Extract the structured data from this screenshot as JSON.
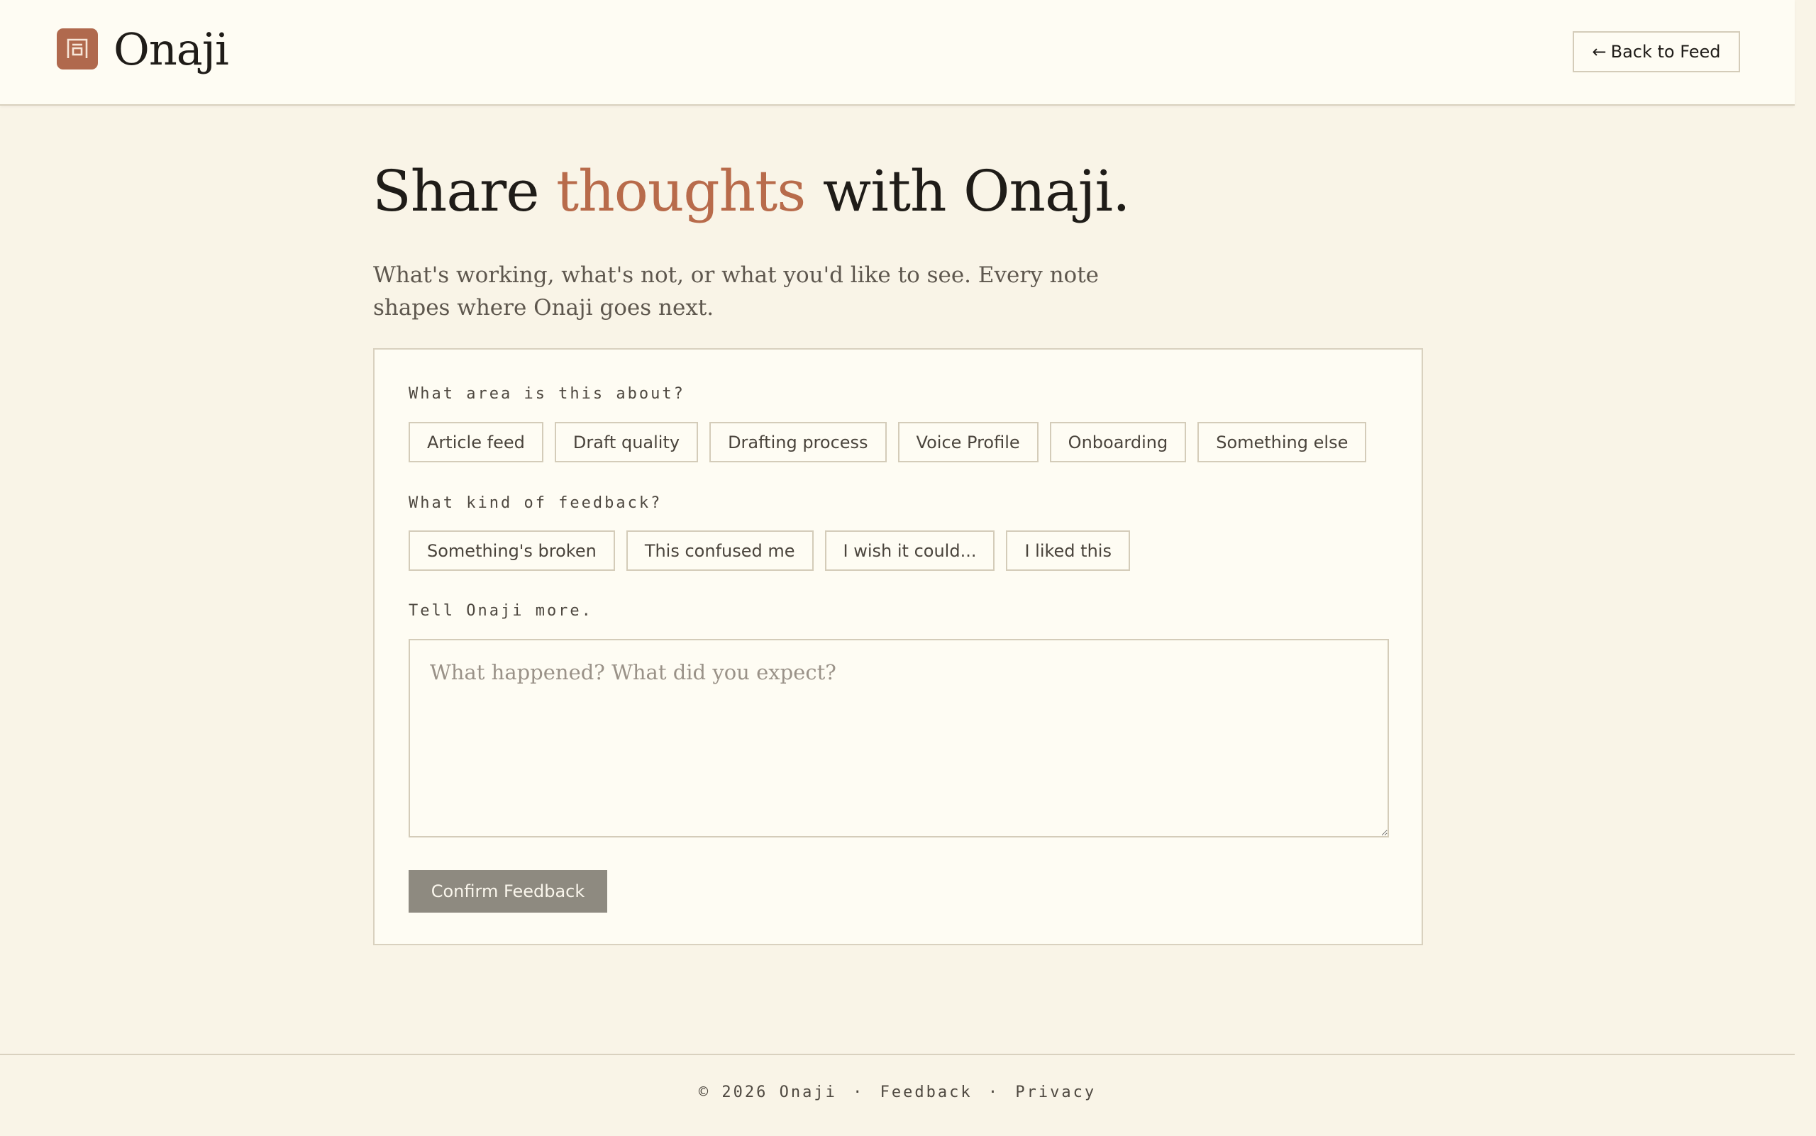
{
  "header": {
    "brand_name": "Onaji",
    "brand_mark_glyph": "同",
    "back_label": "Back to Feed",
    "back_arrow": "←"
  },
  "hero": {
    "headline_before": "Share ",
    "headline_accent": "thoughts",
    "headline_after": " with Onaji.",
    "subtitle": "What's working, what's not, or what you'd like to see. Every note shapes where Onaji goes next."
  },
  "form": {
    "area_label": "What area is this about?",
    "area_options": [
      "Article feed",
      "Draft quality",
      "Drafting process",
      "Voice Profile",
      "Onboarding",
      "Something else"
    ],
    "kind_label": "What kind of feedback?",
    "kind_options": [
      "Something's broken",
      "This confused me",
      "I wish it could...",
      "I liked this"
    ],
    "details_label": "Tell Onaji more.",
    "details_placeholder": "What happened? What did you expect?",
    "details_value": "",
    "submit_label": "Confirm Feedback"
  },
  "footer": {
    "copyright": "© 2026 Onaji",
    "separator": "·",
    "feedback_link": "Feedback",
    "privacy_link": "Privacy"
  },
  "colors": {
    "accent": "#b86b4b",
    "brand_mark": "#b0694d",
    "background": "#f9f4e7",
    "surface": "#fefcf3",
    "submit_disabled": "#8e8a80"
  }
}
